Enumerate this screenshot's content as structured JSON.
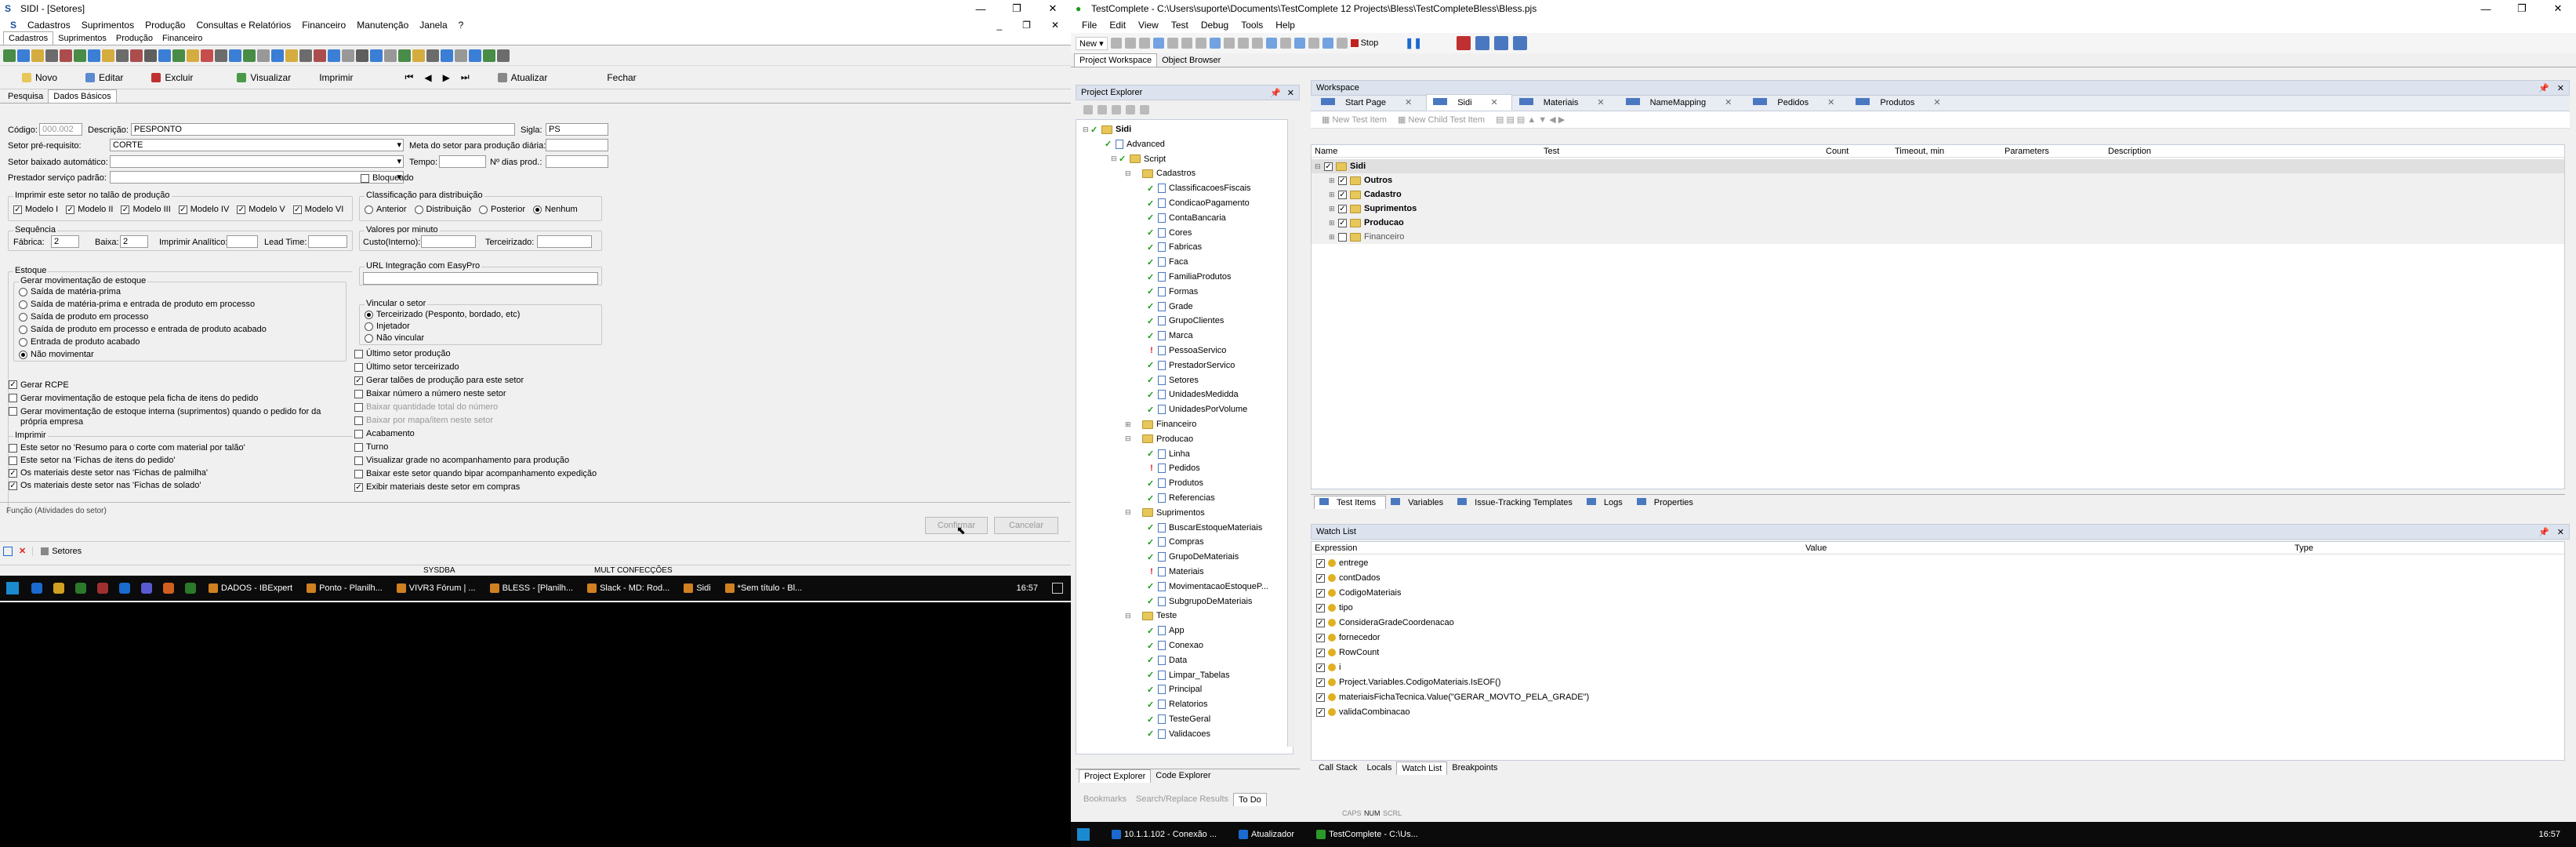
{
  "sidi": {
    "title": "SIDI - [Setores]",
    "menu": [
      "Cadastros",
      "Suprimentos",
      "Produção",
      "Consultas e Relatórios",
      "Financeiro",
      "Manutenção",
      "Janela",
      "?"
    ],
    "module_tabs": [
      "Cadastros",
      "Suprimentos",
      "Produção",
      "Financeiro"
    ],
    "actions": [
      "Novo",
      "Editar",
      "Excluir",
      "Visualizar",
      "Imprimir",
      "Atualizar",
      "Fechar"
    ],
    "page_tabs": [
      "Pesquisa",
      "Dados Básicos"
    ],
    "form": {
      "codigo_label": "Código:",
      "codigo_value": "000.002",
      "descricao_label": "Descrição:",
      "descricao_value": "PESPONTO",
      "sigla_label": "Sigla:",
      "sigla_value": "PS",
      "setor_pre_label": "Setor pré-requisito:",
      "setor_pre_value": "CORTE",
      "meta_label": "Meta do setor para produção diária:",
      "setor_baixado_label": "Setor baixado automático:",
      "tempo_label": "Tempo:",
      "ndias_label": "Nº dias prod.:",
      "prestador_label": "Prestador serviço padrão:",
      "bloqueado_label": "Bloqueado",
      "talao_group": "Imprimir este setor no talão de produção",
      "modelos": [
        "Modelo I",
        "Modelo II",
        "Modelo III",
        "Modelo IV",
        "Modelo V",
        "Modelo VI"
      ],
      "classif_group": "Classificação para distribuição",
      "classif_opts": [
        "Anterior",
        "Distribuição",
        "Posterior",
        "Nenhum"
      ],
      "seq_group": "Sequência",
      "fabrica_label": "Fábrica:",
      "fabrica_value": "2",
      "baixa_label": "Baixa:",
      "baixa_value": "2",
      "imprimir_analitico_label": "Imprimir Analítico:",
      "lead_time_label": "Lead Time:",
      "valores_group": "Valores por minuto",
      "custo_label": "Custo(Interno):",
      "terceirizado_label": "Terceirizado:",
      "estoque_group": "Estoque",
      "gerar_mov_group": "Gerar movimentação de estoque",
      "gerar_mov_opts": [
        "Saída de matéria-prima",
        "Saída de matéria-prima e entrada de produto em processo",
        "Saída de produto em processo",
        "Saída de produto em processo e entrada de produto acabado",
        "Entrada de produto acabado",
        "Não movimentar"
      ],
      "url_group": "URL Integração com EasyPro",
      "vincular_group": "Vincular o setor",
      "vincular_opts": [
        "Terceirizado (Pesponto, bordado, etc)",
        "Injetador",
        "Não vincular"
      ],
      "estoque_checks": [
        "Gerar RCPE",
        "Gerar movimentação de estoque pela ficha de itens do pedido",
        "Gerar movimentação de estoque interna (suprimentos) quando o pedido for da própria empresa"
      ],
      "right_checks": [
        "Último setor produção",
        "Último setor terceirizado",
        "Gerar talões de produção para este setor",
        "Baixar número a número neste setor",
        "Baixar quantidade total do número",
        "Baixar por mapa/item neste setor",
        "Acabamento",
        "Turno",
        "Visualizar grade no acompanhamento para produção",
        "Baixar este setor quando bipar acompanhamento expedição",
        "Exibir materiais deste setor em compras"
      ],
      "imprimir_group": "Imprimir",
      "imprimir_checks": [
        "Este setor no 'Resumo para o corte com material por talão'",
        "Este setor na 'Fichas de itens do pedido'",
        "Os materiais deste setor nas 'Fichas de palmilha'",
        "Os materiais deste setor nas 'Fichas de solado'"
      ],
      "funcao_label": "Função (Atividades do setor)",
      "confirmar": "Confirmar",
      "cancelar": "Cancelar"
    },
    "window_tab": "Setores",
    "status": [
      "SYSDBA",
      "MULT CONFECÇÕES"
    ],
    "taskbar": [
      "DADOS - IBExpert",
      "Ponto - Planilh...",
      "VIVR3 Fórum | ...",
      "BLESS - [Planilh...",
      "Slack - MD: Rod...",
      "Sidi",
      "*Sem título - Bl...",
      "16:57"
    ]
  },
  "tc": {
    "title": "TestComplete - C:\\Users\\suporte\\Documents\\TestComplete 12 Projects\\Bless\\TestCompleteBless\\Bless.pjs",
    "menu": [
      "File",
      "Edit",
      "View",
      "Test",
      "Debug",
      "Tools",
      "Help"
    ],
    "new_label": "New",
    "stop_label": "Stop",
    "workspace_tabs": [
      "Project Workspace",
      "Object Browser"
    ],
    "project_explorer": "Project Explorer",
    "workspace": "Workspace",
    "tree": [
      {
        "t": "Sidi",
        "lvl": 0,
        "s": "ok",
        "folder": true,
        "bold": true
      },
      {
        "t": "Advanced",
        "lvl": 1,
        "s": "ok",
        "folder": false
      },
      {
        "t": "Script",
        "lvl": 2,
        "s": "ok",
        "folder": true
      },
      {
        "t": "Cadastros",
        "lvl": 3,
        "s": "",
        "folder": true
      },
      {
        "t": "ClassificacoesFiscais",
        "lvl": 4,
        "s": "ok"
      },
      {
        "t": "CondicaoPagamento",
        "lvl": 4,
        "s": "ok"
      },
      {
        "t": "ContaBancaria",
        "lvl": 4,
        "s": "ok"
      },
      {
        "t": "Cores",
        "lvl": 4,
        "s": "ok"
      },
      {
        "t": "Fabricas",
        "lvl": 4,
        "s": "ok"
      },
      {
        "t": "Faca",
        "lvl": 4,
        "s": "ok"
      },
      {
        "t": "FamiliaProdutos",
        "lvl": 4,
        "s": "ok"
      },
      {
        "t": "Formas",
        "lvl": 4,
        "s": "ok"
      },
      {
        "t": "Grade",
        "lvl": 4,
        "s": "ok"
      },
      {
        "t": "GrupoClientes",
        "lvl": 4,
        "s": "ok"
      },
      {
        "t": "Marca",
        "lvl": 4,
        "s": "ok"
      },
      {
        "t": "PessoaServico",
        "lvl": 4,
        "s": "bang"
      },
      {
        "t": "PrestadorServico",
        "lvl": 4,
        "s": "ok"
      },
      {
        "t": "Setores",
        "lvl": 4,
        "s": "ok"
      },
      {
        "t": "UnidadesMedidda",
        "lvl": 4,
        "s": "ok"
      },
      {
        "t": "UnidadesPorVolume",
        "lvl": 4,
        "s": "ok"
      },
      {
        "t": "Financeiro",
        "lvl": 3,
        "s": "",
        "folder": true,
        "collapsed": true
      },
      {
        "t": "Producao",
        "lvl": 3,
        "s": "",
        "folder": true
      },
      {
        "t": "Linha",
        "lvl": 4,
        "s": "ok"
      },
      {
        "t": "Pedidos",
        "lvl": 4,
        "s": "bang"
      },
      {
        "t": "Produtos",
        "lvl": 4,
        "s": "ok"
      },
      {
        "t": "Referencias",
        "lvl": 4,
        "s": "ok"
      },
      {
        "t": "Suprimentos",
        "lvl": 3,
        "s": "",
        "folder": true
      },
      {
        "t": "BuscarEstoqueMateriais",
        "lvl": 4,
        "s": "ok"
      },
      {
        "t": "Compras",
        "lvl": 4,
        "s": "ok"
      },
      {
        "t": "GrupoDeMateriais",
        "lvl": 4,
        "s": "ok"
      },
      {
        "t": "Materiais",
        "lvl": 4,
        "s": "bang"
      },
      {
        "t": "MovimentacaoEstoqueP...",
        "lvl": 4,
        "s": "ok"
      },
      {
        "t": "SubgrupoDeMateriais",
        "lvl": 4,
        "s": "ok"
      },
      {
        "t": "Teste",
        "lvl": 3,
        "s": "",
        "folder": true
      },
      {
        "t": "App",
        "lvl": 4,
        "s": "ok"
      },
      {
        "t": "Conexao",
        "lvl": 4,
        "s": "ok"
      },
      {
        "t": "Data",
        "lvl": 4,
        "s": "ok"
      },
      {
        "t": "Limpar_Tabelas",
        "lvl": 4,
        "s": "ok"
      },
      {
        "t": "Principal",
        "lvl": 4,
        "s": "ok"
      },
      {
        "t": "Relatorios",
        "lvl": 4,
        "s": "ok"
      },
      {
        "t": "TesteGeral",
        "lvl": 4,
        "s": "ok"
      },
      {
        "t": "Validacoes",
        "lvl": 4,
        "s": "ok"
      }
    ],
    "pe_bottom_tabs": [
      "Project Explorer",
      "Code Explorer"
    ],
    "ws_tabs": [
      "Start Page",
      "Sidi",
      "Materiais",
      "NameMapping",
      "Pedidos",
      "Produtos"
    ],
    "ws_toolbar": [
      "New Test Item",
      "New Child Test Item"
    ],
    "ti_cols": [
      "Name",
      "Test",
      "Count",
      "Timeout, min",
      "Parameters",
      "Description"
    ],
    "ti_rows": [
      {
        "name": "Sidi",
        "lvl": 0,
        "bold": true,
        "checked": true
      },
      {
        "name": "Outros",
        "lvl": 1,
        "bold": true,
        "checked": true
      },
      {
        "name": "Cadastro",
        "lvl": 1,
        "bold": true,
        "checked": true
      },
      {
        "name": "Suprimentos",
        "lvl": 1,
        "bold": true,
        "checked": true
      },
      {
        "name": "Producao",
        "lvl": 1,
        "bold": true,
        "checked": true
      },
      {
        "name": "Financeiro",
        "lvl": 1,
        "bold": false,
        "checked": false
      }
    ],
    "ti_tabs": [
      "Test Items",
      "Variables",
      "Issue-Tracking Templates",
      "Logs",
      "Properties"
    ],
    "watch_title": "Watch List",
    "watch_cols": [
      "Expression",
      "Value",
      "Type"
    ],
    "watch_rows": [
      "entrege",
      "contDados",
      "CodigoMateriais",
      "tipo",
      "ConsideraGradeCoordenacao",
      "fornecedor",
      "RowCount",
      "i",
      "Project.Variables.CodigoMateriais.IsEOF()",
      "materiaisFichaTecnica.Value(\"GERAR_MOVTO_PELA_GRADE\")",
      "validaCombinacao"
    ],
    "watch_bottom_tabs": [
      "Call Stack",
      "Locals",
      "Watch List",
      "Breakpoints"
    ],
    "bottom_tabs": [
      "Bookmarks",
      "Search/Replace Results",
      "To Do"
    ],
    "caps": [
      "CAPS",
      "NUM",
      "SCRL"
    ],
    "taskbar": [
      "10.1.1.102 - Conexão ...",
      "Atualizador",
      "TestComplete - C:\\Us...",
      "16:57"
    ]
  },
  "colors": {
    "green": "#1a9a1a",
    "red": "#d22222",
    "folder": "#e7c65a",
    "accent": "#1a4e9a"
  }
}
